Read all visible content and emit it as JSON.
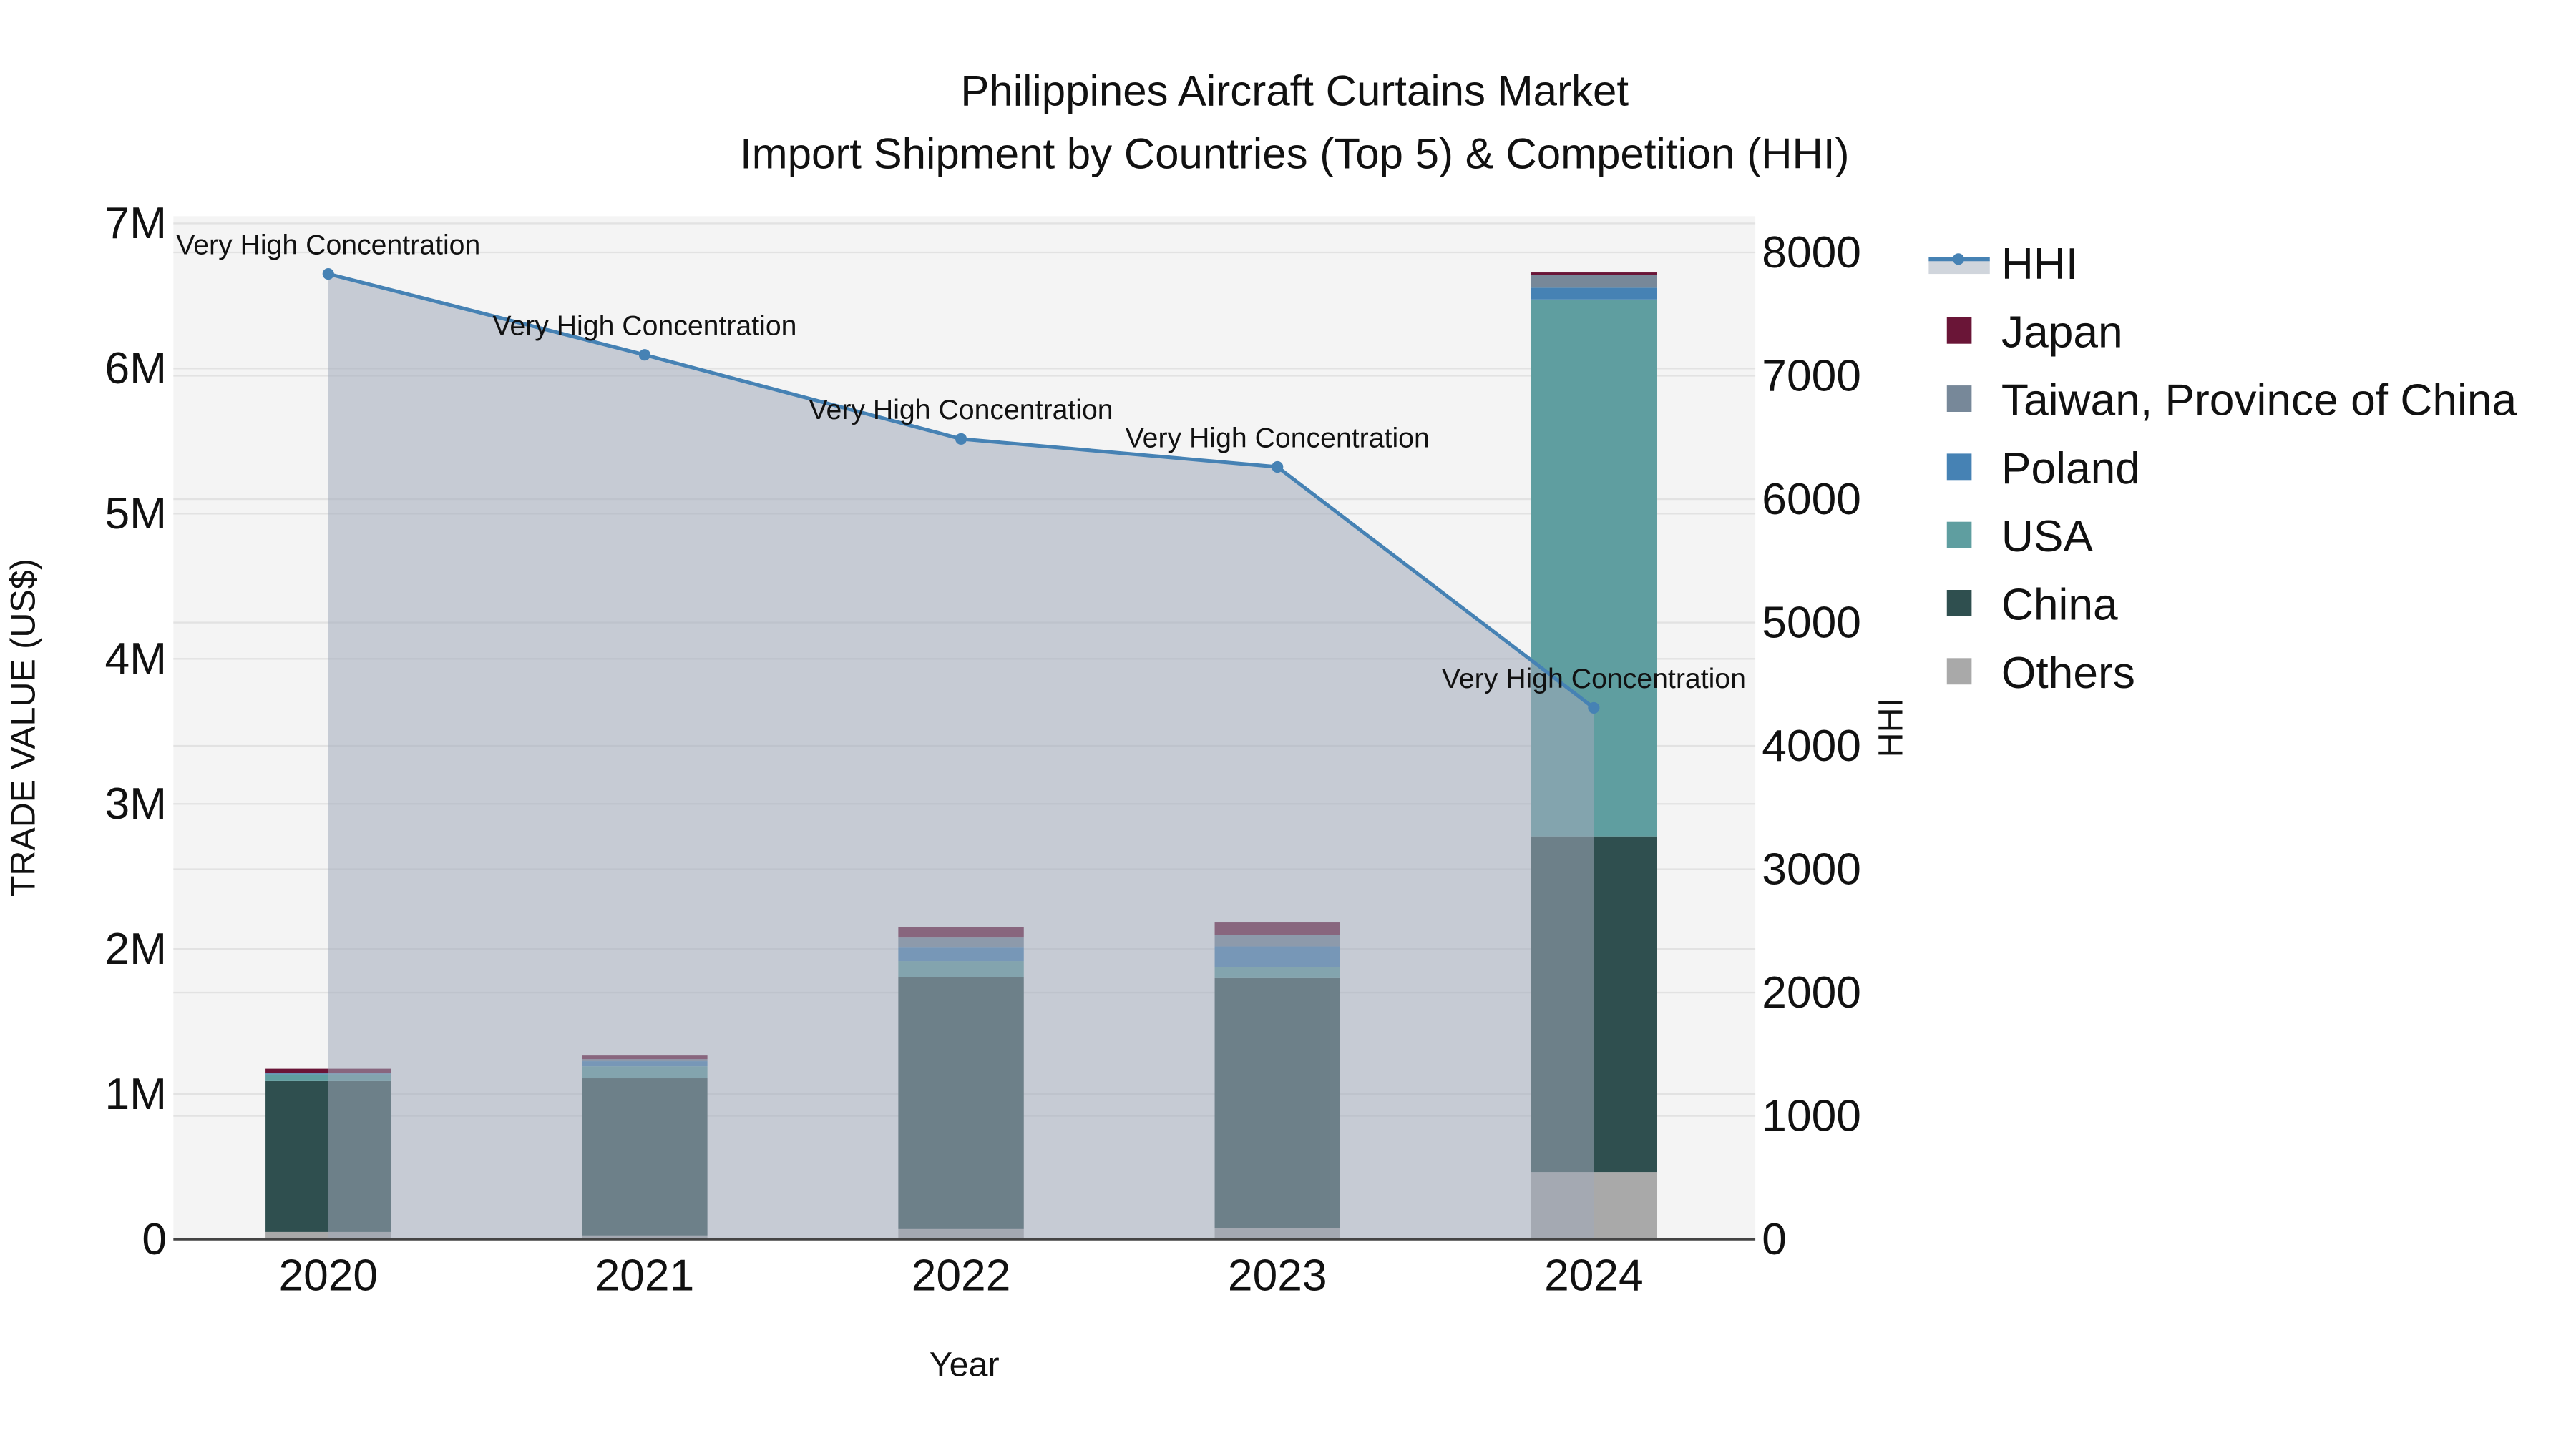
{
  "chart_data": {
    "type": "bar",
    "stacked": true,
    "title": "Philippines Aircraft Curtains Market",
    "subtitle": "Import Shipment by Countries (Top 5) & Competition (HHI)",
    "xlabel": "Year",
    "ylabel": "TRADE VALUE (US$)",
    "y2label": "HHI",
    "categories": [
      "2020",
      "2021",
      "2022",
      "2023",
      "2024"
    ],
    "ylim": [
      0,
      7050000
    ],
    "y2lim": [
      0,
      8294
    ],
    "yticks": [
      0,
      1000000,
      2000000,
      3000000,
      4000000,
      5000000,
      6000000,
      7000000
    ],
    "ytick_labels": [
      "0",
      "1M",
      "2M",
      "3M",
      "4M",
      "5M",
      "6M",
      "7M"
    ],
    "y2ticks": [
      0,
      1000,
      2000,
      3000,
      4000,
      5000,
      6000,
      7000,
      8000
    ],
    "y2tick_labels": [
      "0",
      "1000",
      "2000",
      "3000",
      "4000",
      "5000",
      "6000",
      "7000",
      "8000"
    ],
    "series": [
      {
        "name": "Others",
        "color": "#a9a9a9",
        "values": [
          50000,
          26000,
          70000,
          76000,
          463000
        ]
      },
      {
        "name": "China",
        "color": "#2f4f4f",
        "values": [
          1040000,
          1083000,
          1734000,
          1724000,
          2313000
        ]
      },
      {
        "name": "USA",
        "color": "#5f9ea0",
        "values": [
          47000,
          83000,
          113000,
          74000,
          3700000
        ]
      },
      {
        "name": "Poland",
        "color": "#4682b4",
        "values": [
          5000,
          35000,
          93000,
          144000,
          81000
        ]
      },
      {
        "name": "Taiwan, Province of China",
        "color": "#778899",
        "values": [
          3000,
          14000,
          69000,
          77000,
          90000
        ]
      },
      {
        "name": "Japan",
        "color": "#6a1537",
        "values": [
          30000,
          25000,
          74000,
          88000,
          15000
        ]
      }
    ],
    "line": {
      "name": "HHI",
      "color": "#4682b4",
      "axis": "right",
      "values": [
        7826,
        7170,
        6488,
        6261,
        4308
      ],
      "annotations": [
        "Very High Concentration",
        "Very High Concentration",
        "Very High Concentration",
        "Very High Concentration",
        "Very High Concentration"
      ]
    },
    "legend_order": [
      "HHI",
      "Japan",
      "Taiwan, Province of China",
      "Poland",
      "USA",
      "China",
      "Others"
    ],
    "legend_position": "right",
    "grid": true
  }
}
